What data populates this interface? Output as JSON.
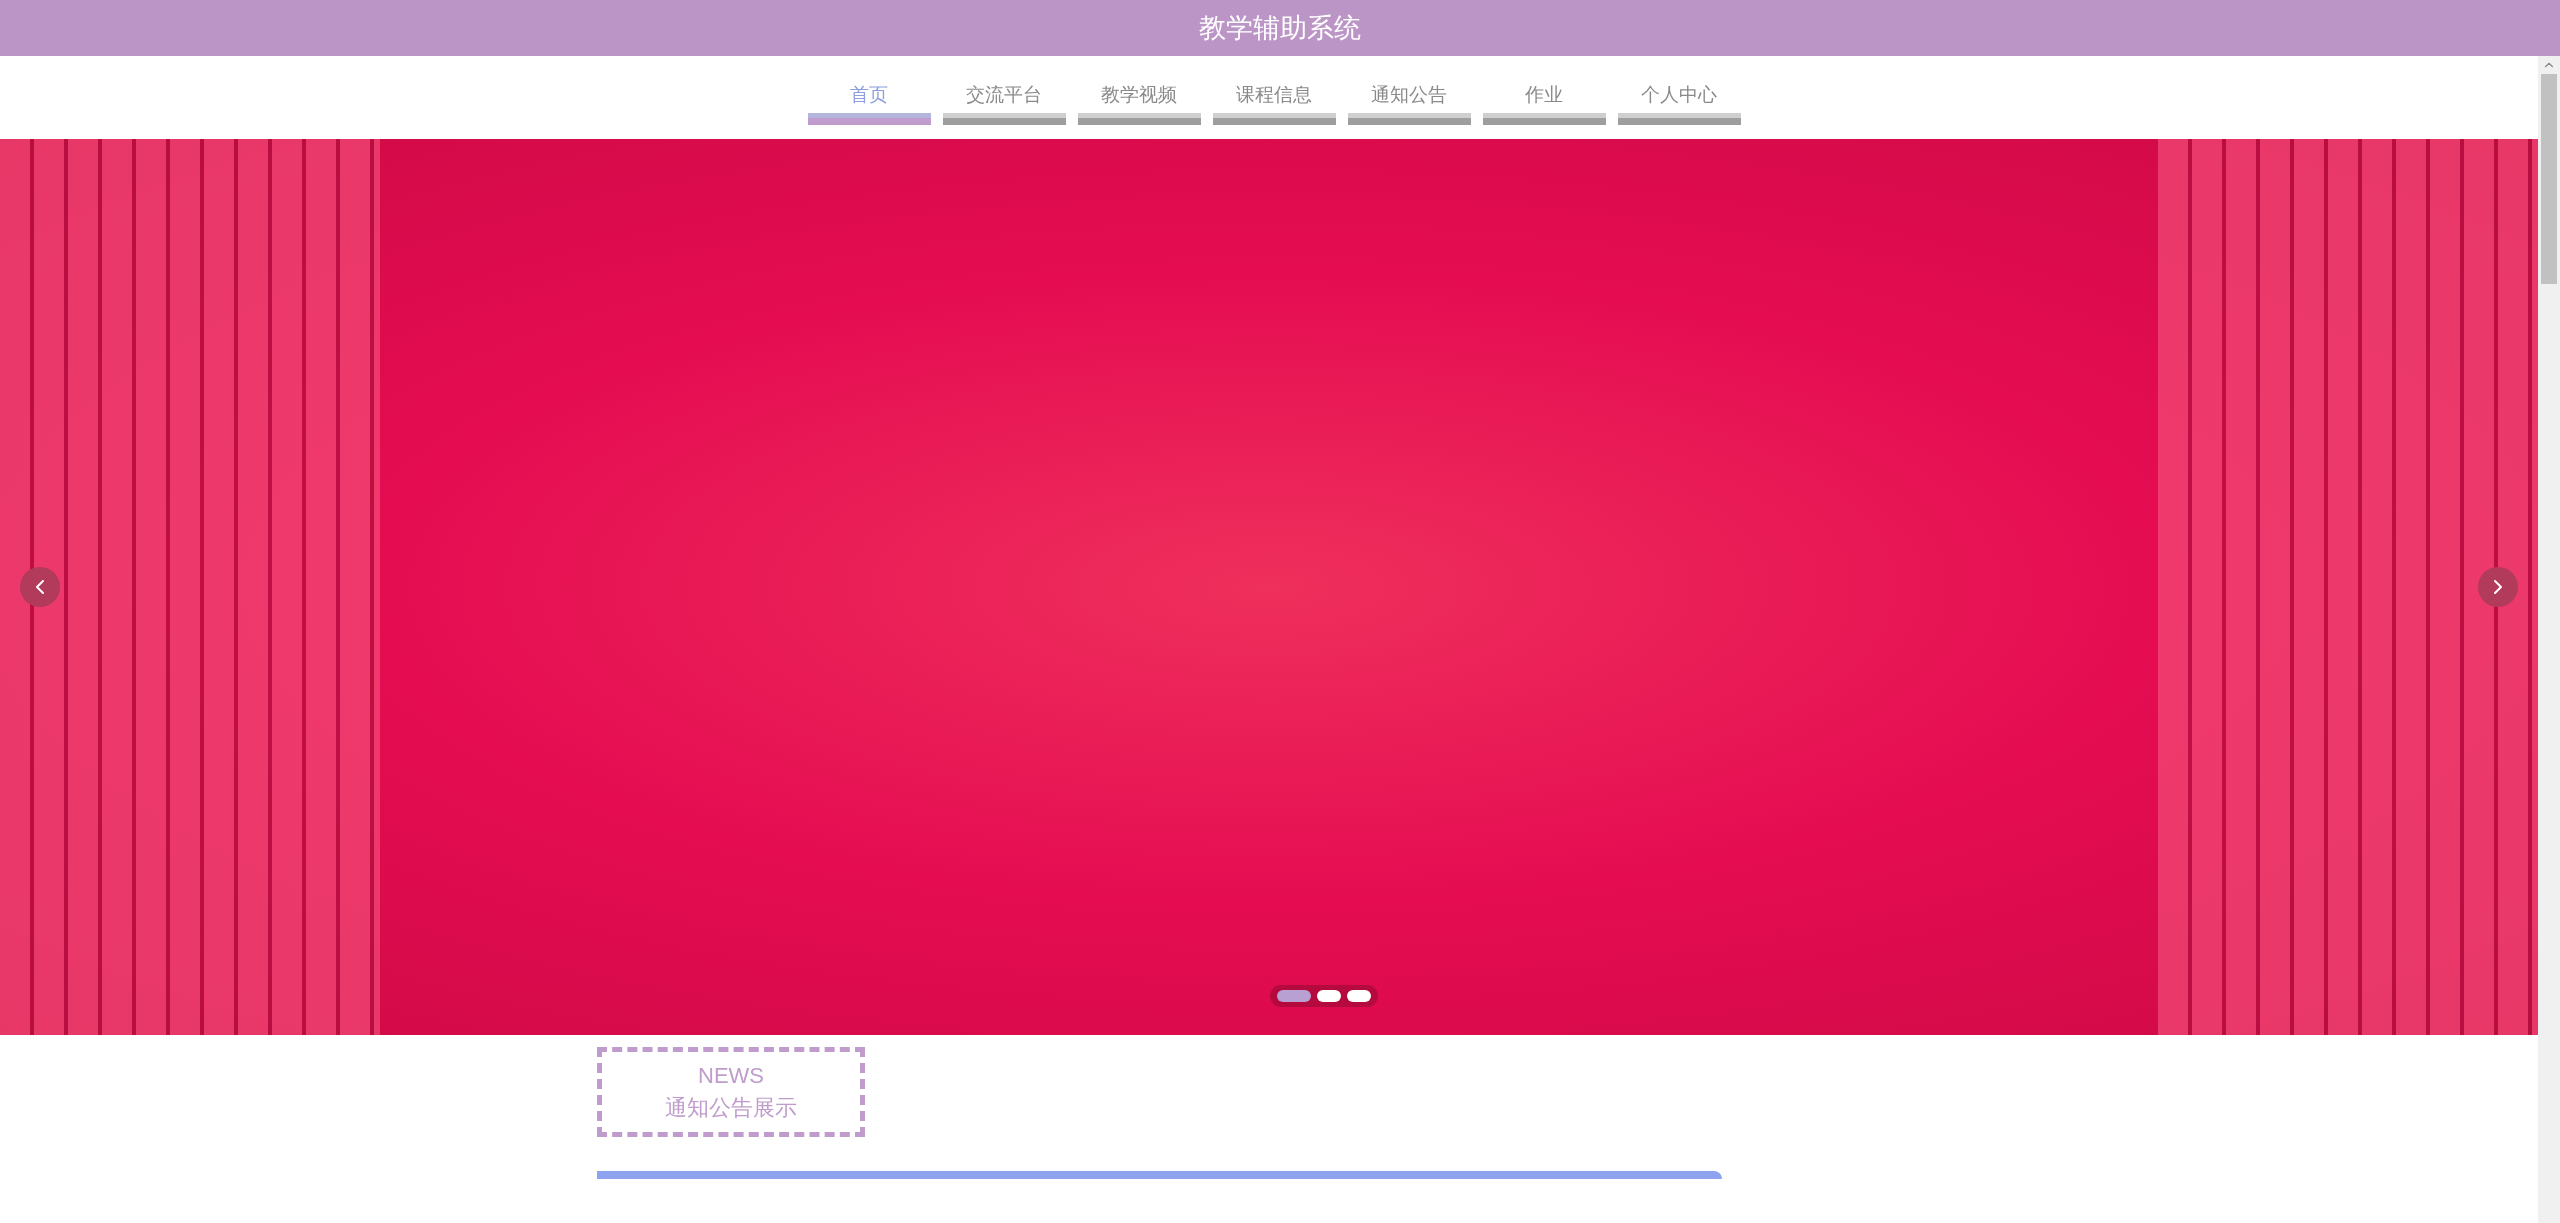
{
  "header": {
    "title": "教学辅助系统"
  },
  "nav": [
    {
      "label": "首页",
      "selected": true
    },
    {
      "label": "交流平台",
      "selected": false
    },
    {
      "label": "教学视频",
      "selected": false
    },
    {
      "label": "课程信息",
      "selected": false
    },
    {
      "label": "通知公告",
      "selected": false
    },
    {
      "label": "作业",
      "selected": false
    },
    {
      "label": "个人中心",
      "selected": false
    }
  ],
  "carousel": {
    "slides": [
      {
        "selected": true
      },
      {
        "selected": false
      },
      {
        "selected": false
      }
    ]
  },
  "news": {
    "label": "NEWS",
    "title": "通知公告展示"
  }
}
